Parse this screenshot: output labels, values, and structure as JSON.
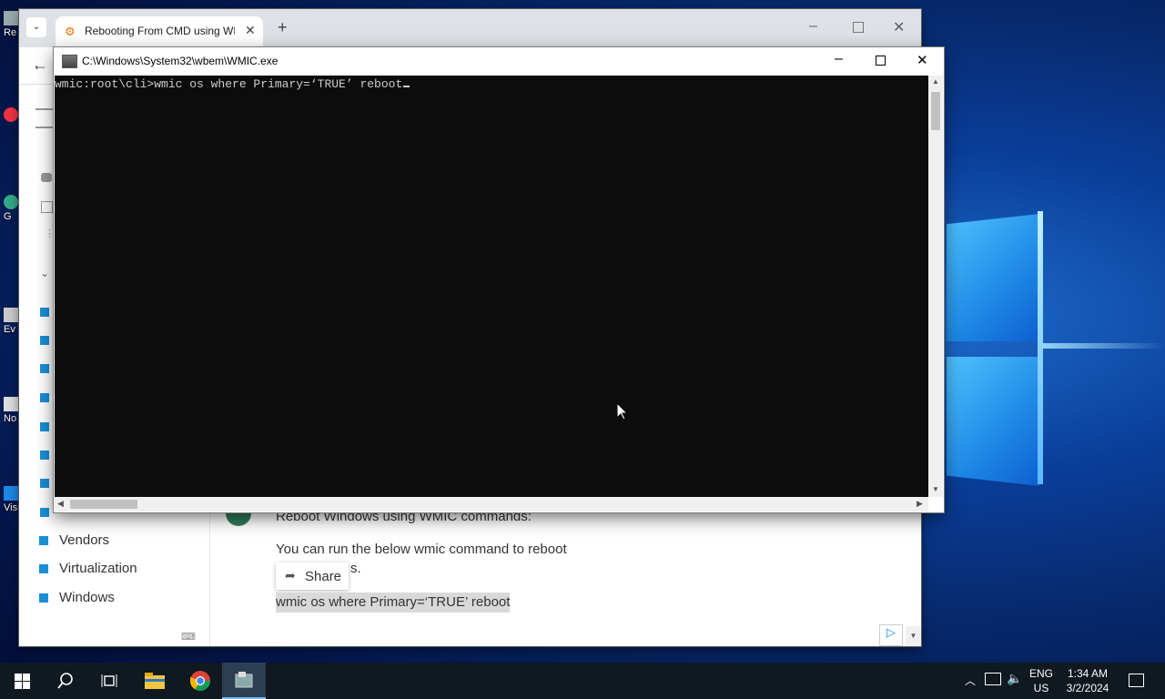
{
  "desktop": {
    "icons": [
      {
        "label": "Re",
        "icon": "recycle-bin-icon"
      },
      {
        "label": "",
        "icon": "app-icon"
      },
      {
        "label": "G",
        "icon": "chrome-icon"
      },
      {
        "label": "Ev",
        "icon": "app-icon"
      },
      {
        "label": "No",
        "icon": "notepad-icon"
      },
      {
        "label": "Visu",
        "icon": "vscode-icon"
      }
    ]
  },
  "browser": {
    "tab_title": "Rebooting From CMD using WMIC",
    "new_tab_symbol": "+",
    "categories": [
      "Vendors",
      "Virtualization",
      "Windows"
    ],
    "article": {
      "heading": "Reboot Windows using WMIC commands:",
      "para_line1": "You can run the below wmic command to reboot",
      "para_line2_tail": "s.",
      "share_label": "Share",
      "code": "wmic os where Primary=‘TRUE’ reboot"
    }
  },
  "cmd": {
    "title": "C:\\Windows\\System32\\wbem\\WMIC.exe",
    "prompt": "wmic:root\\cli>",
    "command": "wmic os where Primary=‘TRUE’ reboot"
  },
  "taskbar": {
    "lang_line1": "ENG",
    "lang_line2": "US",
    "time": "1:34 AM",
    "date": "3/2/2024"
  },
  "colors": {
    "accent": "#1a8fd6",
    "console_bg": "#0c0c0c",
    "console_fg": "#cccccc",
    "taskbar_bg": "#101820"
  }
}
